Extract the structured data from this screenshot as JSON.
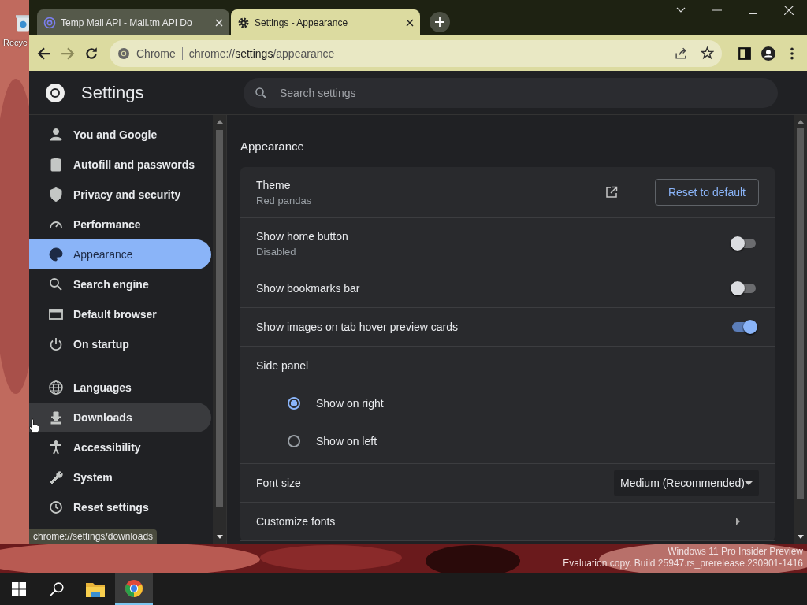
{
  "desktop": {
    "recycle_bin_label": "Recyc",
    "watermark": [
      "Windows 11 Pro Insider Preview",
      "Evaluation copy. Build 25947.rs_prerelease.230901-1416"
    ]
  },
  "tabs": [
    {
      "title": "Temp Mail API - Mail.tm API Do",
      "selected": false
    },
    {
      "title": "Settings - Appearance",
      "selected": true
    }
  ],
  "address_bar": {
    "site_label": "Chrome",
    "url_prefix": "chrome://",
    "url_host": "settings",
    "url_path": "/appearance"
  },
  "settings": {
    "title": "Settings",
    "search": {
      "placeholder": "Search settings"
    }
  },
  "sidebar": {
    "groups": [
      [
        {
          "label": "You and Google",
          "selected": false,
          "hovered": false
        },
        {
          "label": "Autofill and passwords",
          "selected": false,
          "hovered": false
        },
        {
          "label": "Privacy and security",
          "selected": false,
          "hovered": false
        },
        {
          "label": "Performance",
          "selected": false,
          "hovered": false
        },
        {
          "label": "Appearance",
          "selected": true,
          "hovered": false
        },
        {
          "label": "Search engine",
          "selected": false,
          "hovered": false
        },
        {
          "label": "Default browser",
          "selected": false,
          "hovered": false
        },
        {
          "label": "On startup",
          "selected": false,
          "hovered": false
        }
      ],
      [
        {
          "label": "Languages",
          "selected": false,
          "hovered": false
        },
        {
          "label": "Downloads",
          "selected": false,
          "hovered": true
        },
        {
          "label": "Accessibility",
          "selected": false,
          "hovered": false
        },
        {
          "label": "System",
          "selected": false,
          "hovered": false
        },
        {
          "label": "Reset settings",
          "selected": false,
          "hovered": false
        }
      ]
    ]
  },
  "section": {
    "title": "Appearance",
    "rows": [
      {
        "kind": "theme",
        "label": "Theme",
        "sublabel": "Red pandas",
        "button": "Reset to default"
      },
      {
        "kind": "toggle",
        "label": "Show home button",
        "sublabel": "Disabled",
        "on": false
      },
      {
        "kind": "toggle",
        "label": "Show bookmarks bar",
        "on": false
      },
      {
        "kind": "toggle",
        "label": "Show images on tab hover preview cards",
        "on": true
      },
      {
        "kind": "radio",
        "label": "Side panel",
        "options": [
          {
            "label": "Show on right",
            "selected": true
          },
          {
            "label": "Show on left",
            "selected": false
          }
        ]
      },
      {
        "kind": "select",
        "label": "Font size",
        "value": "Medium (Recommended)"
      },
      {
        "kind": "link",
        "label": "Customize fonts"
      }
    ]
  },
  "status_tooltip": "chrome://settings/downloads"
}
